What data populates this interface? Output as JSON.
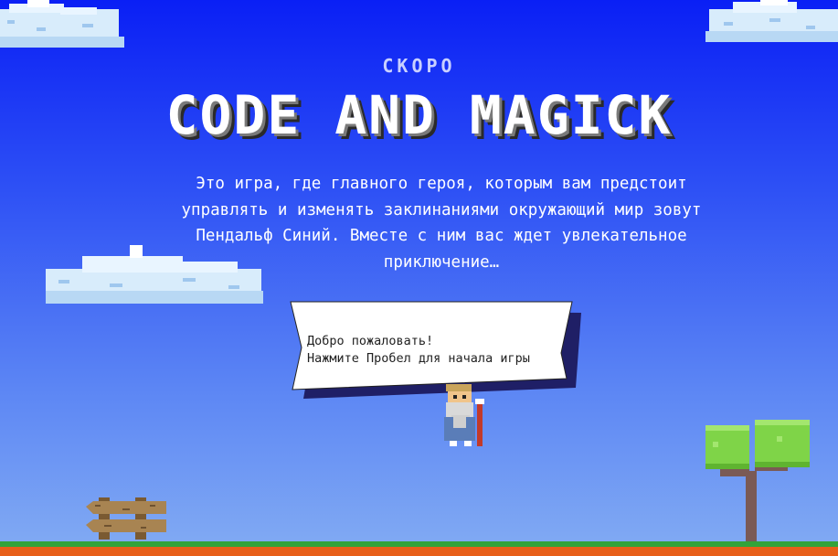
{
  "game": {
    "subtitle": "СКОРО",
    "title": "CODE AND MAGICK",
    "description": "Это игра, где главного героя, которым вам предстоит управлять и изменять заклинаниями окружающий мир зовут Пендальф Синий. Вместе с ним вас ждет увлекательное приключение…"
  },
  "speech_bubble": {
    "line1": "Добро пожаловать!",
    "line2": "Нажмите Пробел для начала игры"
  },
  "colors": {
    "sky_top": "#0a1ff5",
    "sky_bottom": "#83acf3",
    "ground_grass": "#33a33a",
    "ground_dirt": "#e85f19",
    "tree_leaves": "#7fd448",
    "fence_wood": "#9b7b4b"
  },
  "icons": [
    "cloud-icon",
    "wizard-icon",
    "fence-icon",
    "tree-icon"
  ]
}
